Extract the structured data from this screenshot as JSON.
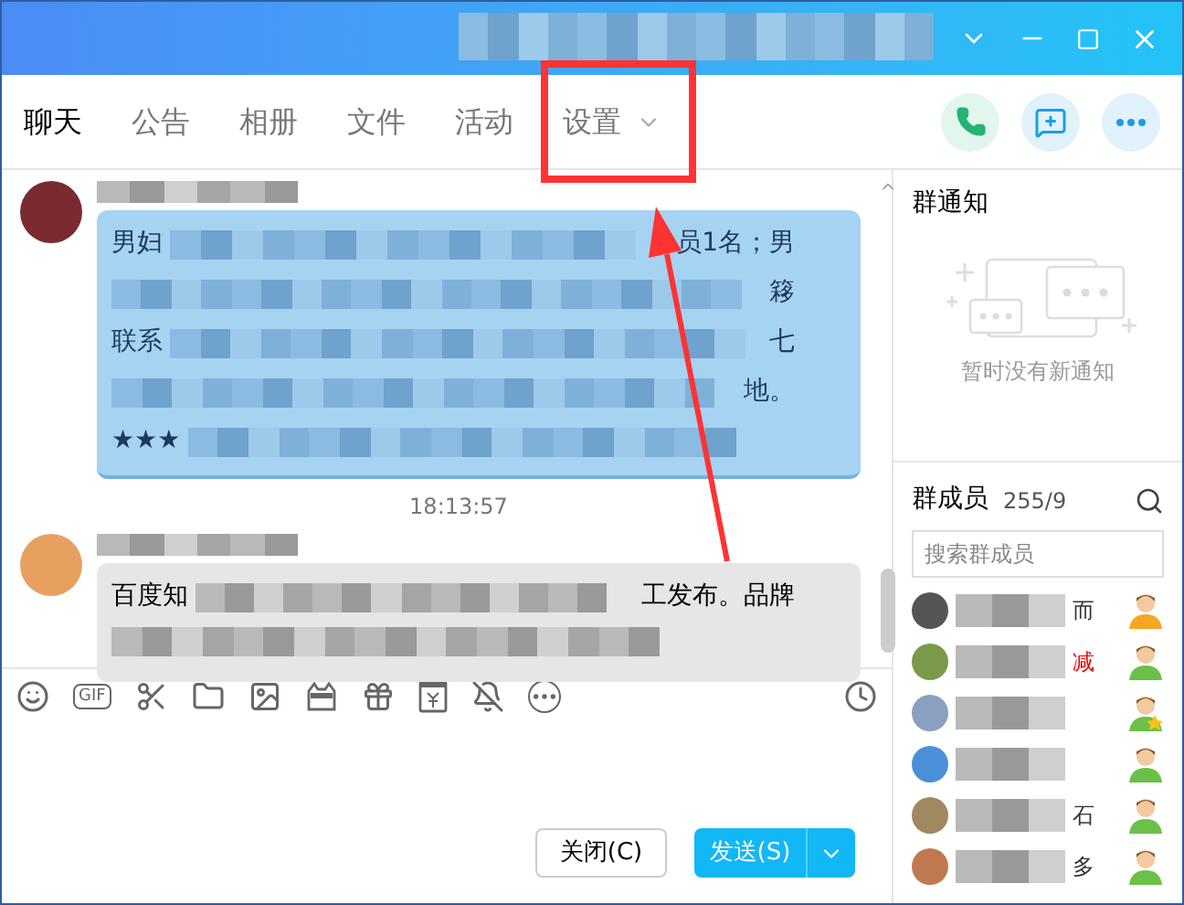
{
  "tabs": [
    {
      "label": "聊天",
      "selected": true,
      "kind": "plain"
    },
    {
      "label": "公告",
      "selected": false,
      "kind": "plain"
    },
    {
      "label": "相册",
      "selected": false,
      "kind": "plain"
    },
    {
      "label": "文件",
      "selected": false,
      "kind": "plain"
    },
    {
      "label": "活动",
      "selected": false,
      "kind": "plain"
    },
    {
      "label": "设置",
      "selected": false,
      "kind": "dropdown"
    }
  ],
  "messages": [
    {
      "kind": "card",
      "lines": [
        {
          "left": "男妇",
          "right": "员1名；男"
        },
        {
          "right": "簃"
        },
        {
          "left": "联系",
          "right": "七"
        },
        {
          "right": "地。"
        },
        {
          "left": "★★★"
        }
      ]
    },
    {
      "kind": "time",
      "text": "18:13:57"
    },
    {
      "kind": "text",
      "lines": [
        {
          "left": "百度知",
          "right": "工发布。品牌"
        }
      ]
    }
  ],
  "notices": {
    "title": "群通知",
    "empty_text": "暂时没有新通知"
  },
  "members": {
    "title": "群成员",
    "count": "255/9",
    "search": {
      "placeholder": "搜索群成员"
    },
    "items": [
      {
        "name": "而",
        "kind": "owner",
        "color": "#333333"
      },
      {
        "name": "减",
        "kind": "member",
        "color": "#ee0000"
      },
      {
        "kind": "admin"
      },
      {
        "kind": "member"
      },
      {
        "name": "石",
        "kind": "member",
        "color": "#333333"
      },
      {
        "name": "多",
        "kind": "member",
        "color": "#333333"
      }
    ]
  },
  "toolbar": {
    "gif": "GIF"
  },
  "buttons": {
    "close": "关闭(C)",
    "send": "发送(S)"
  }
}
